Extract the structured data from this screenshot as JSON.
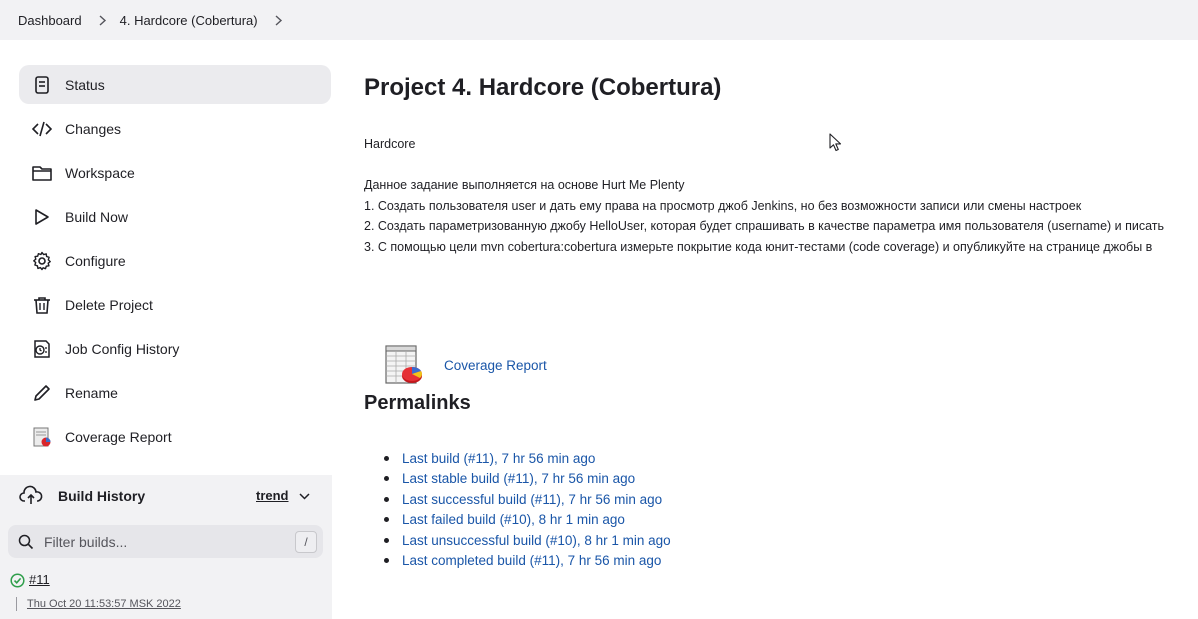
{
  "breadcrumb": {
    "items": [
      "Dashboard",
      "4. Hardcore (Cobertura)"
    ]
  },
  "sidebar": {
    "items": [
      {
        "label": "Status",
        "icon": "status-icon",
        "active": true
      },
      {
        "label": "Changes",
        "icon": "code-icon"
      },
      {
        "label": "Workspace",
        "icon": "folder-icon"
      },
      {
        "label": "Build Now",
        "icon": "play-icon"
      },
      {
        "label": "Configure",
        "icon": "gear-icon"
      },
      {
        "label": "Delete Project",
        "icon": "trash-icon"
      },
      {
        "label": "Job Config History",
        "icon": "config-history-icon"
      },
      {
        "label": "Rename",
        "icon": "pencil-icon"
      },
      {
        "label": "Coverage Report",
        "icon": "coverage-report-icon"
      }
    ]
  },
  "build_history": {
    "title": "Build History",
    "trend": "trend",
    "filter_placeholder": "Filter builds...",
    "shortcut": "/",
    "builds": [
      {
        "number": "#11",
        "time": "Thu Oct 20 11:53:57 MSK 2022",
        "status": "success"
      }
    ]
  },
  "main": {
    "title": "Project 4. Hardcore (Cobertura)",
    "description": {
      "line1": "Hardcore",
      "line2": "Данное задание выполняется на основе Hurt Me Plenty",
      "line3": "1. Создать пользователя user и дать ему права на просмотр джоб Jenkins, но без возможности записи или смены настроек",
      "line4": "2. Создать параметризованную джобу HelloUser, которая будет спрашивать в качестве параметра имя пользователя (username) и писать",
      "line5": "3. С помощью цели  mvn cobertura:cobertura измерьте покрытие кода юнит-тестами (code coverage) и опубликуйте на странице джобы в"
    },
    "coverage_link": "Coverage Report",
    "permalinks_title": "Permalinks",
    "permalinks": [
      "Last build (#11), 7 hr 56 min ago",
      "Last stable build (#11), 7 hr 56 min ago",
      "Last successful build (#11), 7 hr 56 min ago",
      "Last failed build (#10), 8 hr 1 min ago",
      "Last unsuccessful build (#10), 8 hr 1 min ago",
      "Last completed build (#11), 7 hr 56 min ago"
    ]
  },
  "colors": {
    "link": "#1a56a8",
    "success": "#2e9e4a",
    "sidebar_active": "#ebebee",
    "panel_bg": "#f2f2f4"
  }
}
